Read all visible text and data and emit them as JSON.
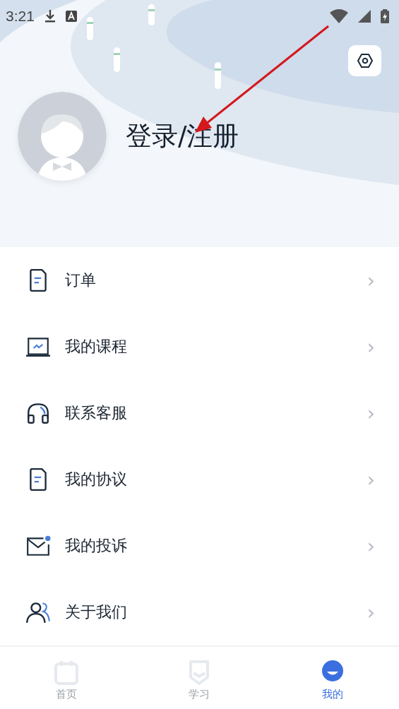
{
  "status_bar": {
    "time": "3:21"
  },
  "profile": {
    "login_text": "登录/注册"
  },
  "menu": [
    {
      "label": "订单",
      "chevron": "›"
    },
    {
      "label": "我的课程",
      "chevron": "›"
    },
    {
      "label": "联系客服",
      "chevron": "›"
    },
    {
      "label": "我的协议",
      "chevron": "›"
    },
    {
      "label": "我的投诉",
      "chevron": "›"
    },
    {
      "label": "关于我们",
      "chevron": "›"
    }
  ],
  "tabs": [
    {
      "label": "首页",
      "selected": false
    },
    {
      "label": "学习",
      "selected": false
    },
    {
      "label": "我的",
      "selected": true
    }
  ]
}
